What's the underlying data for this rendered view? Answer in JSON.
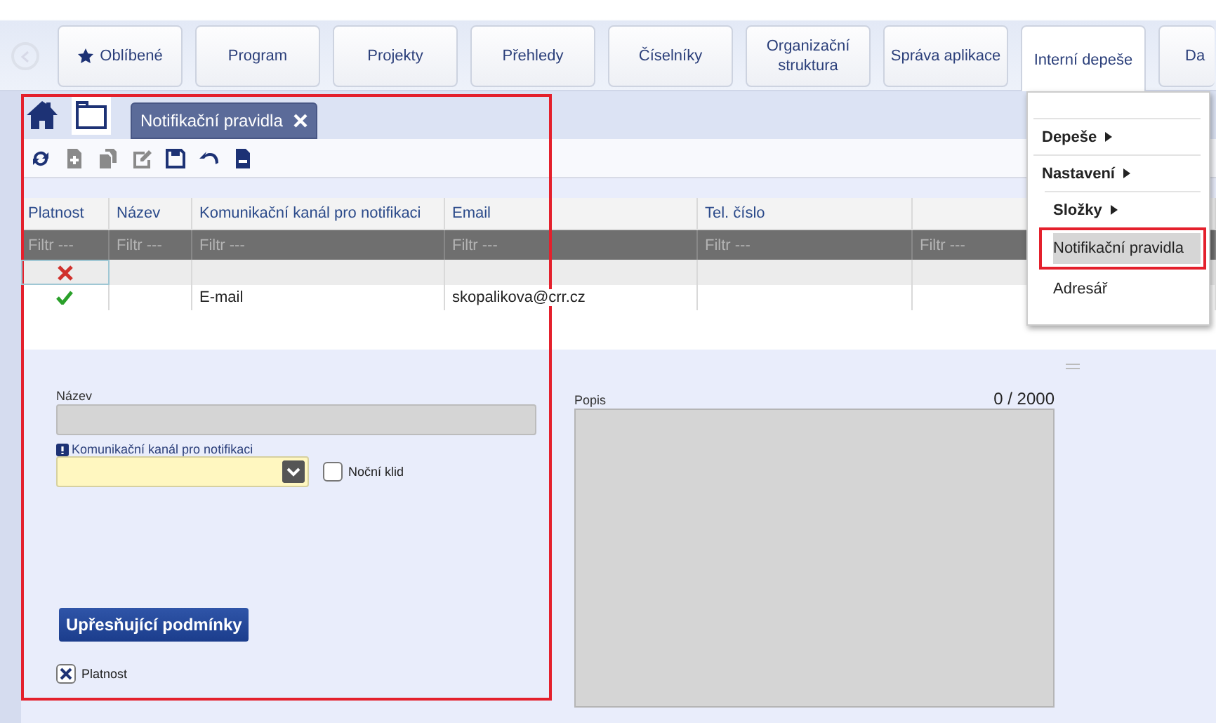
{
  "nav": {
    "back_disabled": true,
    "items": [
      {
        "label": "Oblíbené",
        "kind": "favorites",
        "selected": false
      },
      {
        "label": "Program",
        "kind": "plain",
        "selected": false
      },
      {
        "label": "Projekty",
        "kind": "plain",
        "selected": false
      },
      {
        "label": "Přehledy",
        "kind": "plain",
        "selected": false
      },
      {
        "label": "Číselníky",
        "kind": "plain",
        "selected": false
      },
      {
        "label": "Organizační struktura",
        "kind": "plain",
        "selected": false
      },
      {
        "label": "Správa aplikace",
        "kind": "plain",
        "selected": false
      },
      {
        "label": "Interní depeše",
        "kind": "plain",
        "selected": true
      },
      {
        "label": "Da",
        "kind": "plain",
        "selected": false
      }
    ]
  },
  "tabs": [
    {
      "label": "Notifikační pravidla",
      "selected": true
    }
  ],
  "toolbar": [
    {
      "kind": "refresh",
      "disabled": false
    },
    {
      "kind": "add",
      "disabled": true
    },
    {
      "kind": "copy",
      "disabled": true
    },
    {
      "kind": "edit",
      "disabled": true
    },
    {
      "kind": "save",
      "disabled": false
    },
    {
      "kind": "undo",
      "disabled": false
    },
    {
      "kind": "remove",
      "disabled": false
    }
  ],
  "table": {
    "columns": [
      "Platnost",
      "Název",
      "Komunikační kanál pro notifikaci",
      "Email",
      "Tel. číslo"
    ],
    "filter_placeholder": [
      "Filtr ---",
      "Filtr ---",
      "Filtr ---",
      "Filtr ---",
      "Filtr ---",
      "Filtr ---"
    ],
    "rows": [
      {
        "valid": false,
        "selected": true,
        "cells": [
          "",
          "",
          "",
          "",
          ""
        ]
      },
      {
        "valid": true,
        "selected": false,
        "cells": [
          "",
          "",
          "E-mail",
          "skopalikova@crr.cz",
          ""
        ]
      }
    ]
  },
  "menu": {
    "items": [
      {
        "label": "Depeše",
        "kind": "submenu",
        "selected": false,
        "highlighted": false
      },
      {
        "label": "Nastavení",
        "kind": "submenu",
        "selected": false,
        "highlighted": false,
        "children": [
          {
            "label": "Složky",
            "kind": "submenu",
            "selected": false,
            "highlighted": false
          },
          {
            "label": "Notifikační pravidla",
            "kind": "item",
            "selected": true,
            "highlighted": true
          },
          {
            "label": "Adresář",
            "kind": "item",
            "selected": false,
            "highlighted": false
          }
        ]
      }
    ]
  },
  "form": {
    "highlighted": true,
    "name": {
      "label": "Název"
    },
    "channel": {
      "label": "Komunikační kanál pro notifikaci",
      "required": true
    },
    "night_quiet": {
      "label": "Noční klid",
      "checked": false
    },
    "conditions_button": "Upřesňující podmínky",
    "valid": {
      "label": "Platnost",
      "checked": true
    },
    "description": {
      "label": "Popis",
      "counter": "0 / 2000"
    }
  }
}
